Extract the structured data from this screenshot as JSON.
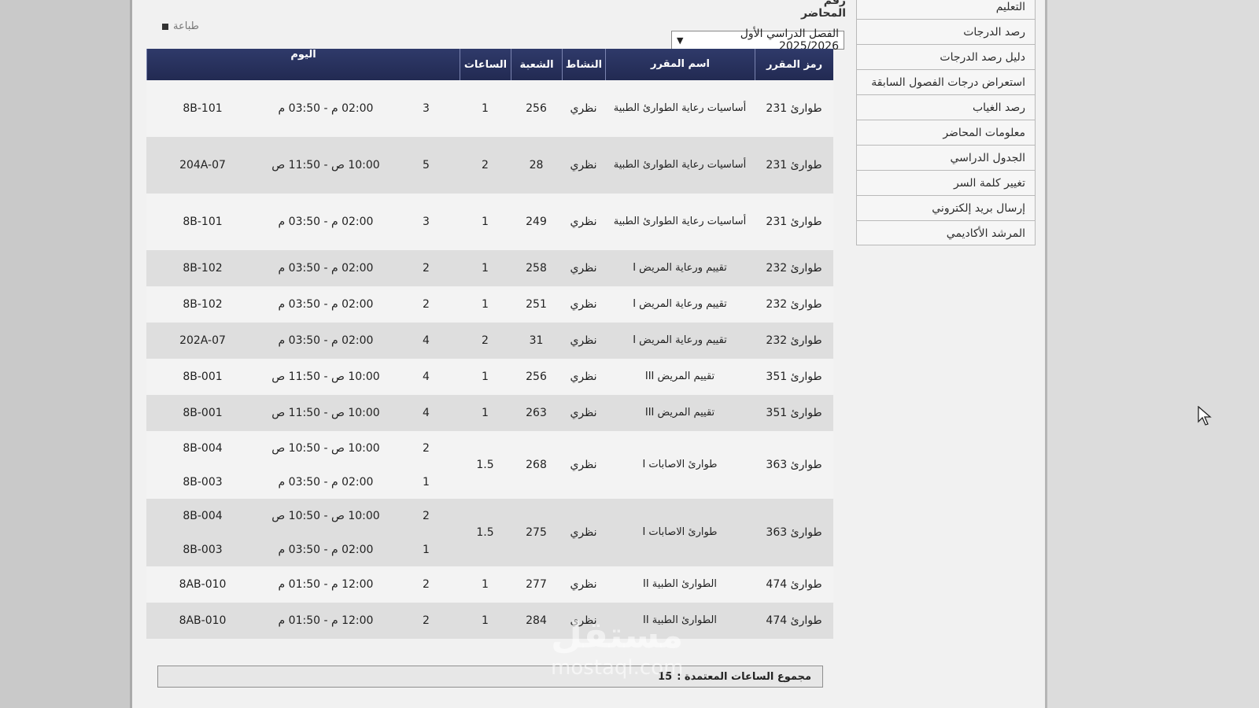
{
  "header": {
    "lecturer_label": "رقم المحاضر",
    "print_label": "طباعة",
    "semester": "الفصل الدراسي الأول 2025/2026"
  },
  "sidebar": {
    "items": [
      {
        "label": "التعليم"
      },
      {
        "label": "رصد الدرجات"
      },
      {
        "label": "دليل رصد الدرجات"
      },
      {
        "label": "استعراض درجات الفصول السابقة"
      },
      {
        "label": "رصد الغياب"
      },
      {
        "label": "معلومات المحاضر"
      },
      {
        "label": "الجدول الدراسي"
      },
      {
        "label": "تغيير كلمة السر"
      },
      {
        "label": "إرسال بريد إلكتروني"
      },
      {
        "label": "المرشد الأكاديمي"
      }
    ]
  },
  "table": {
    "headers": {
      "code": "رمز المقرر",
      "name": "اسم المقرر",
      "activity": "النشاط",
      "section": "الشعبة",
      "hours": "الساعات",
      "day": "اليوم"
    },
    "rows": [
      {
        "code": "طوارئ 231",
        "name": "أساسيات رعاية الطوارئ الطبية",
        "activity": "نظري",
        "section": "256",
        "hours": "1",
        "slots": [
          {
            "count": "3",
            "time": "02:00 م - 03:50 م",
            "room": "8B-101"
          }
        ]
      },
      {
        "code": "طوارئ 231",
        "name": "أساسيات رعاية الطوارئ الطبية",
        "activity": "نظري",
        "section": "28",
        "hours": "2",
        "slots": [
          {
            "count": "5",
            "time": "10:00 ص - 11:50 ص",
            "room": "204A-07"
          }
        ]
      },
      {
        "code": "طوارئ 231",
        "name": "أساسيات رعاية الطوارئ الطبية",
        "activity": "نظري",
        "section": "249",
        "hours": "1",
        "slots": [
          {
            "count": "3",
            "time": "02:00 م - 03:50 م",
            "room": "8B-101"
          }
        ]
      },
      {
        "code": "طوارئ 232",
        "name": "تقييم ورعاية المريض I",
        "activity": "نظري",
        "section": "258",
        "hours": "1",
        "slots": [
          {
            "count": "2",
            "time": "02:00 م - 03:50 م",
            "room": "8B-102"
          }
        ]
      },
      {
        "code": "طوارئ 232",
        "name": "تقييم ورعاية المريض I",
        "activity": "نظري",
        "section": "251",
        "hours": "1",
        "slots": [
          {
            "count": "2",
            "time": "02:00 م - 03:50 م",
            "room": "8B-102"
          }
        ]
      },
      {
        "code": "طوارئ 232",
        "name": "تقييم ورعاية المريض I",
        "activity": "نظري",
        "section": "31",
        "hours": "2",
        "slots": [
          {
            "count": "4",
            "time": "02:00 م - 03:50 م",
            "room": "202A-07"
          }
        ]
      },
      {
        "code": "طوارئ 351",
        "name": "تقييم المريض III",
        "activity": "نظري",
        "section": "256",
        "hours": "1",
        "slots": [
          {
            "count": "4",
            "time": "10:00 ص - 11:50 ص",
            "room": "8B-001"
          }
        ]
      },
      {
        "code": "طوارئ 351",
        "name": "تقييم المريض III",
        "activity": "نظري",
        "section": "263",
        "hours": "1",
        "slots": [
          {
            "count": "4",
            "time": "10:00 ص - 11:50 ص",
            "room": "8B-001"
          }
        ]
      },
      {
        "code": "طوارئ 363",
        "name": "طوارئ الاصابات I",
        "activity": "نظري",
        "section": "268",
        "hours": "1.5",
        "slots": [
          {
            "count": "2",
            "time": "10:00 ص - 10:50 ص",
            "room": "8B-004"
          },
          {
            "count": "1",
            "time": "02:00 م - 03:50 م",
            "room": "8B-003"
          }
        ]
      },
      {
        "code": "طوارئ 363",
        "name": "طوارئ الاصابات I",
        "activity": "نظري",
        "section": "275",
        "hours": "1.5",
        "slots": [
          {
            "count": "2",
            "time": "10:00 ص - 10:50 ص",
            "room": "8B-004"
          },
          {
            "count": "1",
            "time": "02:00 م - 03:50 م",
            "room": "8B-003"
          }
        ]
      },
      {
        "code": "طوارئ 474",
        "name": "الطوارئ الطبية II",
        "activity": "نظري",
        "section": "277",
        "hours": "1",
        "slots": [
          {
            "count": "2",
            "time": "12:00 م - 01:50 م",
            "room": "8AB-010"
          }
        ]
      },
      {
        "code": "طوارئ 474",
        "name": "الطوارئ الطبية II",
        "activity": "نظري",
        "section": "284",
        "hours": "1",
        "slots": [
          {
            "count": "2",
            "time": "12:00 م - 01:50 م",
            "room": "8AB-010"
          }
        ]
      }
    ]
  },
  "totals": {
    "label": "مجموع الساعات المعتمدة :",
    "value": "15"
  },
  "watermark": {
    "text": "مستقل",
    "sub": "mostaql.com"
  }
}
